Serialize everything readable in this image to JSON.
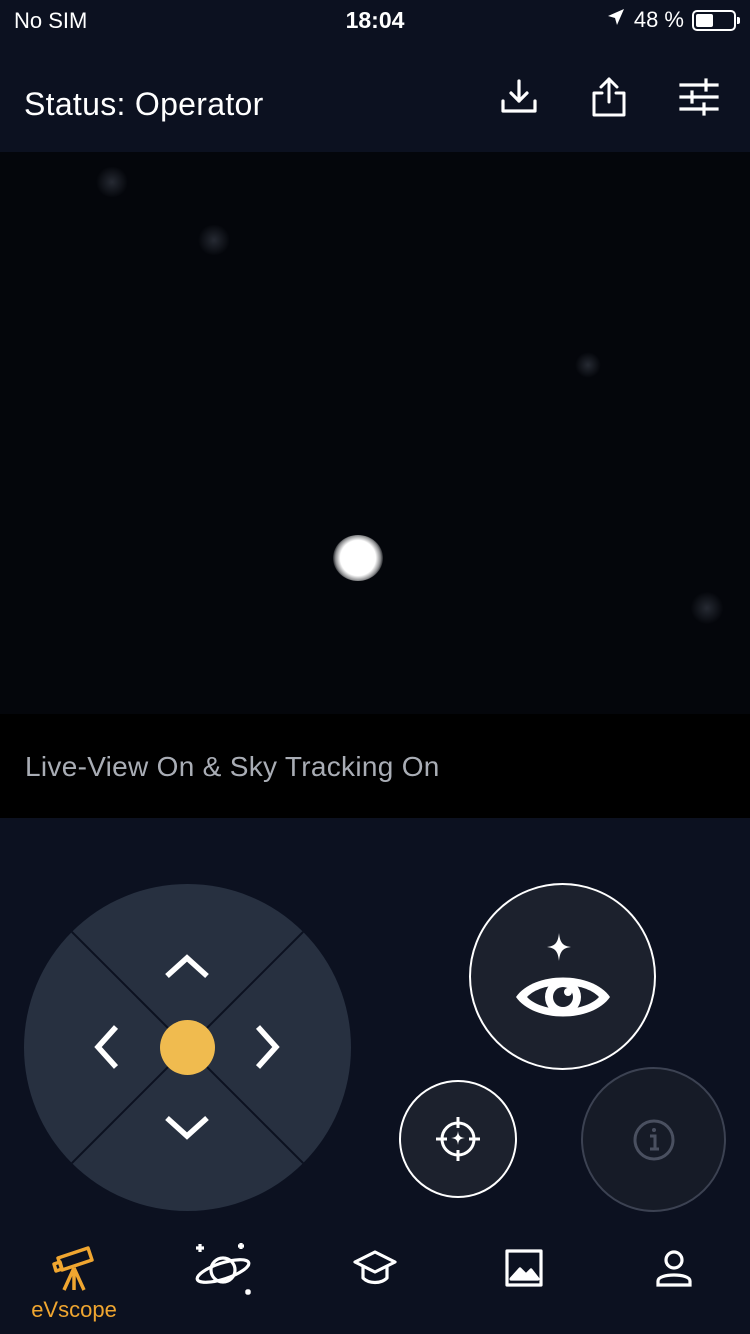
{
  "status_bar": {
    "carrier": "No SIM",
    "time": "18:04",
    "battery_text": "48 %",
    "battery_level": 0.48
  },
  "header": {
    "title": "Status: Operator",
    "actions": [
      "download-icon",
      "share-icon",
      "settings-sliders-icon"
    ]
  },
  "viewer": {
    "caption": "Live-View On & Sky Tracking On"
  },
  "controls": {
    "dpad_icons": [
      "chevron-up-icon",
      "chevron-left-icon",
      "chevron-right-icon",
      "chevron-down-icon"
    ],
    "center_color": "#f0bb4f",
    "buttons": [
      "live-view-eye-icon",
      "crosshair-target-icon",
      "info-icon"
    ]
  },
  "tabbar": {
    "active_color": "#f0a630",
    "tabs": [
      {
        "icon": "telescope-icon",
        "label": "eVscope",
        "active": true
      },
      {
        "icon": "planet-icon",
        "label": "",
        "active": false
      },
      {
        "icon": "graduation-cap-icon",
        "label": "",
        "active": false
      },
      {
        "icon": "image-icon",
        "label": "",
        "active": false
      },
      {
        "icon": "user-icon",
        "label": "",
        "active": false
      }
    ]
  }
}
